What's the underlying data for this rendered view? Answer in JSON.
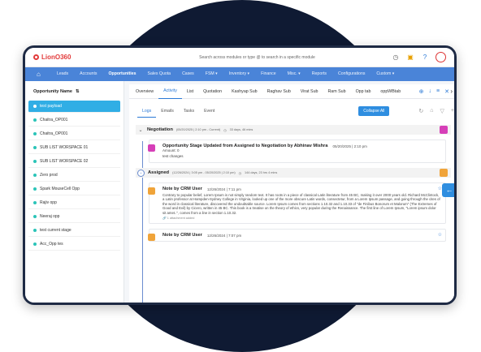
{
  "app": {
    "logo_text": "LionO360",
    "search_placeholder": "Search across modules or type @ to search in a specific module"
  },
  "nav": {
    "items": [
      "Leads",
      "Accounts",
      "Opportunities",
      "Sales Quota",
      "Cases",
      "FSM ▾",
      "Inventory ▾",
      "Finance",
      "Misc. ▾",
      "Reports",
      "Configurations",
      "Custom ▾"
    ],
    "active": "Opportunities"
  },
  "sidebar": {
    "title": "Opportunity Name",
    "items": [
      "test payload",
      "Chaitra_OP001",
      "Chaitra_OP001",
      "SUB LIST WORSPACE 01",
      "SUB LIST WORSPACE 02",
      "Zero prod",
      "Spark MouseCell Opp",
      "Rajiv opp",
      "Neeraj opp",
      "test current stage",
      "Acc_Opp tes"
    ],
    "active_index": 0
  },
  "tabs": {
    "items": [
      "Overview",
      "Activity",
      "List",
      "Quotation",
      "Kashyap Sub",
      "Raghav Sub",
      "Virat Sub",
      "Ram Sub",
      "Opp tab",
      "oppWBtab"
    ],
    "active": "Activity"
  },
  "subtabs": {
    "items": [
      "Logs",
      "Emails",
      "Tasks",
      "Event"
    ],
    "active": "Logs",
    "collapse_label": "Collapse All"
  },
  "timeline": {
    "negotiation": {
      "name": "Negotiation",
      "meta": "(05/20/2025 | 2:10 pm - Current)",
      "duration": "33 days, 46 mins",
      "card": {
        "title": "Opportunity Stage Updated from Assigned to Negotiation by Abhinav Mishra",
        "date": "05/20/2025 | 2:10 pm",
        "amount": "Amount: 0",
        "changes": "test changes"
      }
    },
    "assigned": {
      "name": "Assigned",
      "meta": "(12/26/2024 | 3:05 pm - 05/20/2025 | 2:10 pm)",
      "duration": "144 days, 23 hrs 4 mins",
      "notes": [
        {
          "title": "Note by CRM User",
          "date": "12/26/2024 | 7:11 pm",
          "text": "Contrary to popular belief, Lorem Ipsum is not simply random text. It has roots in a piece of classical Latin literature from 45 BC, making it over 2000 years old. Richard McClintock, a Latin professor at Hampden-Sydney College in Virginia, looked up one of the more obscure Latin words, consectetur, from a Lorem Ipsum passage, and going through the cites of the word in classical literature, discovered the undoubtable source. Lorem Ipsum comes from sections 1.10.32 and 1.10.33 of \"de Finibus Bonorum et Malorum\" (The Extremes of Good and Evil) by Cicero, written in 45 BC. This book is a treatise on the theory of ethics, very popular during the Renaissance. The first line of Lorem Ipsum, \"Lorem ipsum dolor sit amet..\", comes from a line in section 1.10.32.",
          "attachment": "1 attachment added"
        },
        {
          "title": "Note by CRM User",
          "date": "12/26/2024 | 7:07 pm"
        }
      ]
    }
  },
  "colors": {
    "nav_bg": "#4a84d8",
    "accent": "#2b79d6",
    "sidebar_active": "#30aee5",
    "note_icon": "#f0a43a",
    "stage_icon": "#d63fb8"
  }
}
